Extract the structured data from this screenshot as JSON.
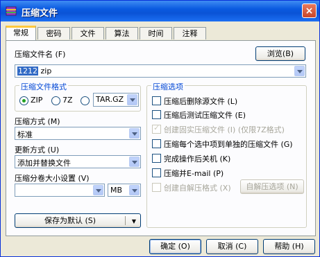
{
  "window": {
    "title": "压缩文件",
    "close_label": "×"
  },
  "tabs": [
    {
      "label": "常规",
      "active": true
    },
    {
      "label": "密码"
    },
    {
      "label": "文件"
    },
    {
      "label": "算法"
    },
    {
      "label": "时间"
    },
    {
      "label": "注释"
    }
  ],
  "archive_name": {
    "label": "压缩文件名 (F)",
    "browse_label": "浏览(B)",
    "value_selected": "1212",
    "value_rest": " zip"
  },
  "format_group": {
    "title": "压缩文件格式",
    "options": [
      "ZIP",
      "7Z",
      ""
    ],
    "selected": "ZIP",
    "tar_value": "TAR.GZ"
  },
  "method": {
    "label": "压缩方式 (M)",
    "value": "标准"
  },
  "update": {
    "label": "更新方式 (U)",
    "value": "添加并替换文件"
  },
  "split": {
    "label": "压缩分卷大小设置 (V)",
    "value": "",
    "unit": "MB"
  },
  "save_default_label": "保存为默认 (S)",
  "options_group": {
    "title": "压缩选项",
    "items": [
      {
        "label": "压缩后删除源文件 (L)",
        "checked": false,
        "disabled": false
      },
      {
        "label": "压缩后测试压缩文件 (E)",
        "checked": false,
        "disabled": false
      },
      {
        "label": "创建固实压缩文件 (I) (仅限7Z格式)",
        "checked": true,
        "disabled": true
      },
      {
        "label": "压缩每个选中项到单独的压缩文件 (G)",
        "checked": false,
        "disabled": false
      },
      {
        "label": "完成操作后关机 (K)",
        "checked": false,
        "disabled": false
      },
      {
        "label": "压缩并E-mail (P)",
        "checked": false,
        "disabled": false
      },
      {
        "label": "创建自解压格式 (X)",
        "checked": false,
        "disabled": true
      }
    ],
    "sfx_button_label": "自解压选项 (N)"
  },
  "footer": {
    "ok_label": "确定 (O)",
    "cancel_label": "取消 (C)",
    "help_label": "帮助 (H)"
  },
  "colors": {
    "titlebar": "#0a5ae0",
    "group_title": "#0046d5",
    "tab_active_accent": "#ffc83c"
  }
}
